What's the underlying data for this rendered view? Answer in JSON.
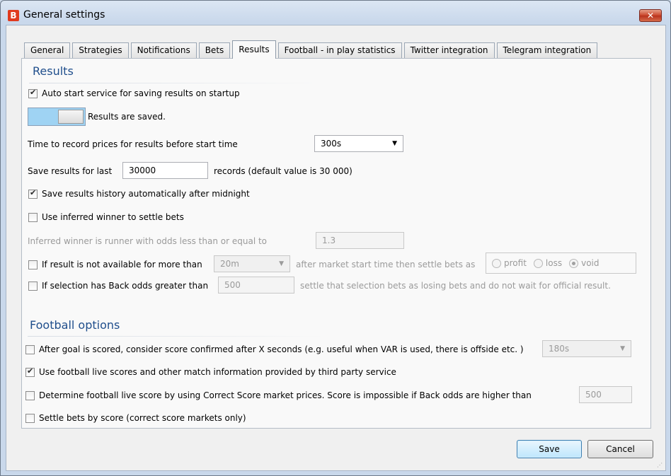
{
  "window": {
    "title": "General settings",
    "app_icon_letter": "B",
    "close_glyph": "✕"
  },
  "tabs": [
    {
      "label": "General"
    },
    {
      "label": "Strategies"
    },
    {
      "label": "Notifications"
    },
    {
      "label": "Bets"
    },
    {
      "label": "Results",
      "active": true
    },
    {
      "label": "Football - in play statistics"
    },
    {
      "label": "Twitter integration"
    },
    {
      "label": "Telegram integration"
    }
  ],
  "results": {
    "title": "Results",
    "auto_start": {
      "label": "Auto start service for saving results on startup",
      "checked": true
    },
    "toggle_status": "Results are saved.",
    "record_prices": {
      "label": "Time to record prices for results before start time",
      "value": "300s"
    },
    "save_last": {
      "label": "Save results for last",
      "value": "30000",
      "suffix": "records (default value is 30 000)"
    },
    "history_midnight": {
      "label": "Save results history automatically after midnight",
      "checked": true
    },
    "inferred_winner": {
      "label": "Use inferred winner to settle bets",
      "checked": false
    },
    "inferred_odds": {
      "label": "Inferred winner is runner with odds less than or equal to",
      "value": "1.3"
    },
    "not_available": {
      "label": "If result is not available for more than",
      "value": "20m",
      "suffix": "after market start time then settle bets as",
      "options": [
        "profit",
        "loss",
        "void"
      ],
      "selected": "void",
      "checked": false
    },
    "back_odds": {
      "label": "If selection has Back odds greater than",
      "value": "500",
      "suffix": "settle that selection bets as losing bets and do not wait for official result.",
      "checked": false
    }
  },
  "football": {
    "title": "Football options",
    "goal_confirm": {
      "label": "After goal is scored, consider score confirmed after X seconds (e.g. useful when VAR is used, there is offside etc. )",
      "value": "180s",
      "checked": false
    },
    "live_scores": {
      "label": "Use football live scores and other match information provided by third party service",
      "checked": true
    },
    "correct_score": {
      "label": "Determine football live score by using Correct Score market prices. Score is impossible if Back odds are higher than",
      "value": "500",
      "checked": false
    },
    "settle_by_score": {
      "label": "Settle bets by score (correct score markets only)",
      "checked": false
    }
  },
  "buttons": {
    "save": "Save",
    "cancel": "Cancel"
  }
}
